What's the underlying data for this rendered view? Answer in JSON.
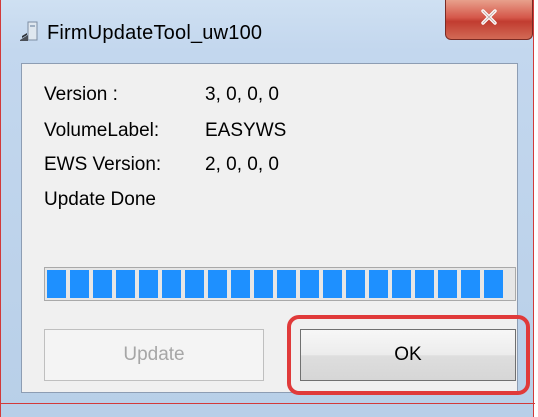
{
  "window": {
    "title": "FirmUpdateTool_uw100"
  },
  "info": {
    "version_label": "Version :",
    "version_value": "3, 0, 0, 0",
    "volume_label": "VolumeLabel:",
    "volume_value": "EASYWS",
    "ews_label": "EWS Version:",
    "ews_value": "2, 0, 0, 0",
    "status": "Update Done"
  },
  "progress": {
    "percent": 100,
    "color": "#1e90ff"
  },
  "buttons": {
    "update_label": "Update",
    "ok_label": "OK"
  },
  "colors": {
    "highlight": "#e03a3a",
    "close_button": "#c94a3c"
  },
  "icons": {
    "app": "installer-icon",
    "close": "close-icon"
  }
}
